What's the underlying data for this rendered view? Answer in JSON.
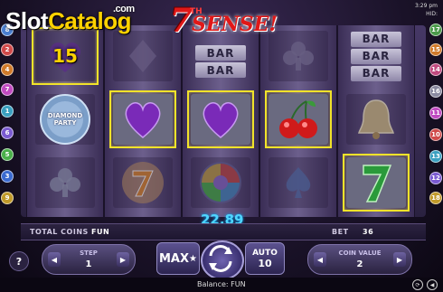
{
  "watermark": {
    "brand_a": "Slot",
    "brand_b": "Catalog",
    "tld": ".com"
  },
  "logo": {
    "seven": "7",
    "th": "TH",
    "sense": "SENSE!"
  },
  "status": {
    "time": "3:29 pm",
    "hid": "HID:"
  },
  "paylines_left": [
    "8",
    "2",
    "4",
    "7",
    "1",
    "6",
    "5",
    "3",
    "9"
  ],
  "paylines_right": [
    "17",
    "15",
    "14",
    "16",
    "11",
    "10",
    "13",
    "12",
    "18"
  ],
  "reels": {
    "r1": {
      "win_value": "15",
      "top_symbol": "heart-15",
      "mid_symbol": "diamond-party",
      "mid_label": "DIAMOND PARTY",
      "bot_symbol": "club"
    },
    "r2": {
      "top_symbol": "diamond",
      "mid_symbol": "purple-heart",
      "bot_symbol": "seven-orange"
    },
    "r3": {
      "bar_top": [
        "BAR",
        "BAR"
      ],
      "mid_symbol": "purple-heart",
      "bot_symbol": "wild-puzzle"
    },
    "r4": {
      "top_symbol": "club",
      "mid_symbol": "cherries",
      "bot_symbol": "spade"
    },
    "r5": {
      "bar_top": [
        "BAR",
        "BAR",
        "BAR"
      ],
      "mid_symbol": "bell",
      "bot_symbol": "seven-green"
    }
  },
  "info": {
    "total_coins_label": "TOTAL COINS",
    "total_coins_value": "FUN",
    "win_amount": "22.89",
    "bet_label": "BET",
    "bet_value": "36"
  },
  "controls": {
    "help": "?",
    "step_label": "STEP",
    "step_value": "1",
    "max_label": "MAX",
    "auto_label": "AUTO",
    "auto_value": "10",
    "coin_value_label": "COIN VALUE",
    "coin_value": "2"
  },
  "footer": {
    "balance": "Balance: FUN"
  },
  "colors": {
    "win_outline": "#f1e32a",
    "win_amount": "#4fd6ff",
    "bg": "#1a1228"
  }
}
